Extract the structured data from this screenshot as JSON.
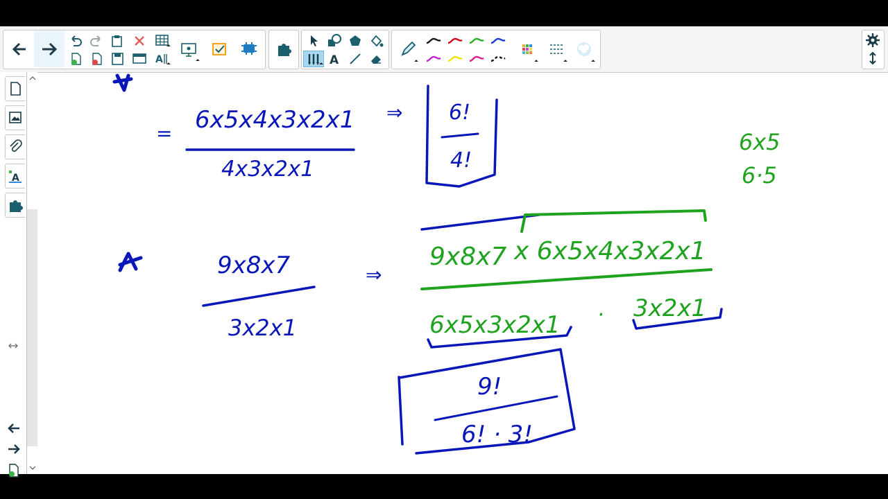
{
  "toolbar": {
    "nav": [
      "back-arrow-icon",
      "forward-arrow-icon"
    ],
    "edit_tools": [
      "undo-icon",
      "redo-icon",
      "paste-icon",
      "delete-icon",
      "table-icon",
      "add-page-icon",
      "delete-page-icon",
      "save-icon",
      "screen-shade-icon",
      "measurement-tools-icon"
    ],
    "addons": [
      "screen-capture-icon",
      "response-icon",
      "activity-builder-icon",
      "add-ons-icon"
    ],
    "tools": [
      "select-icon",
      "shapes-icon",
      "polygon-icon",
      "fill-icon",
      "pens-icon",
      "text-icon",
      "lines-icon",
      "eraser-icon"
    ],
    "pen_colors": [
      "#1a1a1a",
      "#d0021b",
      "#2bb01f",
      "#1b3bd1",
      "#c027c9",
      "#f5e400",
      "#e0208f",
      "#111111"
    ],
    "right": [
      "settings-icon",
      "move-toolbar-icon"
    ]
  },
  "sidebar": {
    "tabs": [
      "page-sorter-icon",
      "gallery-icon",
      "attachments-icon",
      "properties-icon",
      "add-ons-tab-icon"
    ],
    "bottom": [
      "previous-page-icon",
      "next-page-icon",
      "add-page-icon",
      "delete-page-icon"
    ]
  },
  "colors": {
    "ink_blue": "#0a17b8",
    "ink_green": "#1fa31f",
    "ui_teal": "#1b5f6e"
  },
  "board": {
    "line1": {
      "mark": "★",
      "eq": "=",
      "numerator": "6x5x4x3x2x1",
      "denominator": "4x3x2x1",
      "arrow": "⇒",
      "box_num": "6!",
      "box_den": "4!"
    },
    "side_note": {
      "top": "6x5",
      "bottom": "6·5"
    },
    "line2": {
      "mark": "★",
      "numerator": "9x8x7",
      "denominator": "3x2x1",
      "arrow": "⇒",
      "big_num_left": "9x8x7",
      "big_num_right": "x 6x5x4x3x2x1",
      "big_den_left": "6x5x3x2x1",
      "dot": "·",
      "big_den_right": "3x2x1",
      "box_num": "9!",
      "box_den": "6! · 3!"
    }
  }
}
